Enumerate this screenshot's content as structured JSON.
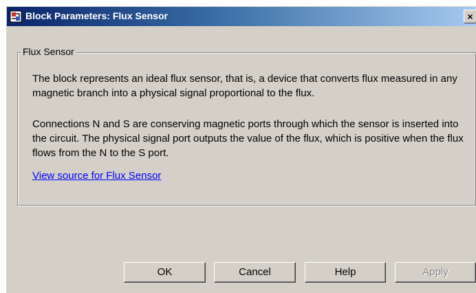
{
  "window": {
    "title": "Block Parameters: Flux Sensor",
    "close_label": "×",
    "background": "#d4d0c8",
    "titlebar_color": "#0a246a"
  },
  "group": {
    "legend": "Flux Sensor",
    "paragraph_1": "The block represents an ideal flux sensor, that is, a device that converts flux measured in any magnetic branch into a physical signal proportional to the flux.",
    "paragraph_2": "Connections N and S are conserving magnetic ports through which the sensor is inserted into the circuit. The physical signal port outputs the value of the flux, which is positive when the flux flows from the N to the S port.",
    "link": "View source for Flux Sensor"
  },
  "buttons": {
    "ok": "OK",
    "cancel": "Cancel",
    "help": "Help",
    "apply": "Apply"
  },
  "icons": {
    "app": "simulink-block-icon",
    "close": "close-icon"
  }
}
